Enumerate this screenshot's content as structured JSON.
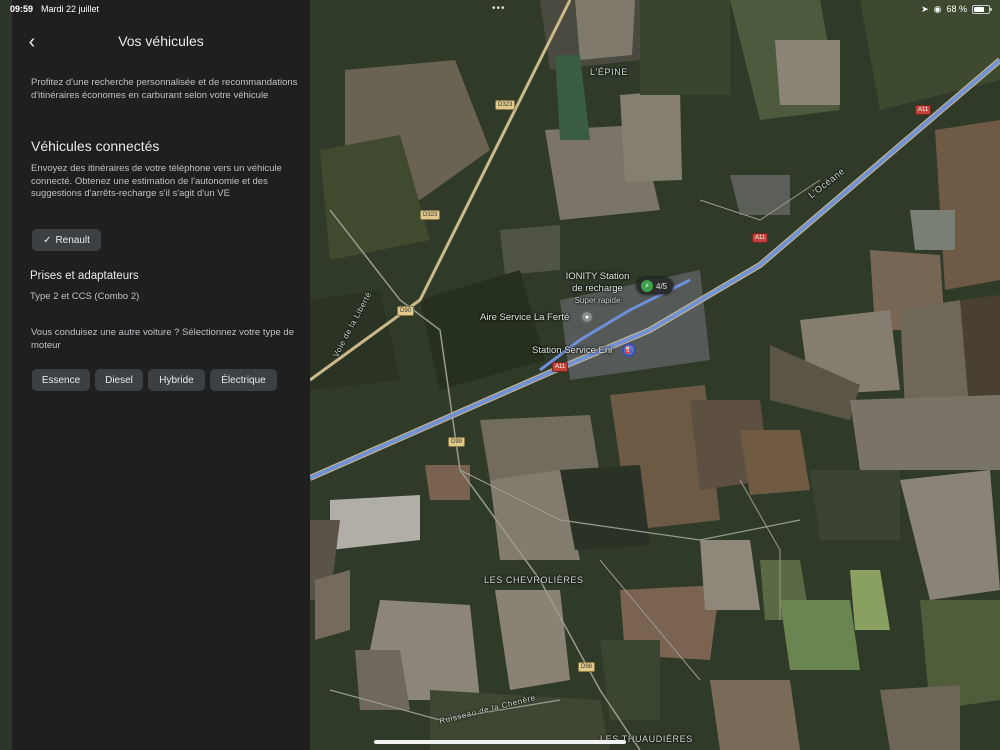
{
  "status_bar": {
    "time": "09:59",
    "date": "Mardi 22 juillet",
    "dots": "•••",
    "battery_text": "68 %",
    "battery_level": 0.68,
    "location_icon": "location-arrow-icon",
    "privacy_icon": "eye-icon"
  },
  "panel": {
    "back_icon": "chevron-left-icon",
    "title": "Vos véhicules",
    "intro": "Profitez d'une recherche personnalisée et de recommandations d'itinéraires économes en carburant selon votre véhicule",
    "connected": {
      "title": "Véhicules connectés",
      "description": "Envoyez des itinéraires de votre téléphone vers un véhicule connecté. Obtenez une estimation de l'autonomie et des suggestions d'arrêts-recharge s'il s'agit d'un VE",
      "vehicle_label": "Renault",
      "vehicle_icon": "check-icon"
    },
    "plugs": {
      "title": "Prises et adaptateurs",
      "value": "Type 2 et CCS (Combo 2)"
    },
    "other_car": {
      "text": "Vous conduisez une autre voiture ? Sélectionnez votre type de moteur",
      "engines": [
        "Essence",
        "Diesel",
        "Hybride",
        "Électrique"
      ]
    }
  },
  "map": {
    "places": {
      "lepine": "L'ÉPINE",
      "chevrolieres": "LES CHEVROLIÈRES",
      "thuaudieres": "LES THUAUDIÈRES"
    },
    "road_names": {
      "ocean": "L'Océane",
      "voie": "Voie de la Liberté",
      "ruisseau": "Ruisseau de la Chenère"
    },
    "pois": {
      "ionity_line1": "IONITY Station",
      "ionity_line2": "de recharge",
      "ionity_sub": "Super rapide",
      "ionity_badge": "4/5",
      "aire": "Aire Service La Ferté",
      "station_eni": "Station Service Eni"
    },
    "shields": {
      "d323_a": "D323",
      "d323_b": "D323",
      "a11_a": "A11",
      "a11_b": "A11",
      "d90": "D90",
      "d99": "D99",
      "d98": "D98"
    },
    "colors": {
      "route": "#6f8fd8",
      "panel": "#1f1f1f",
      "chip": "#3c4043"
    }
  }
}
